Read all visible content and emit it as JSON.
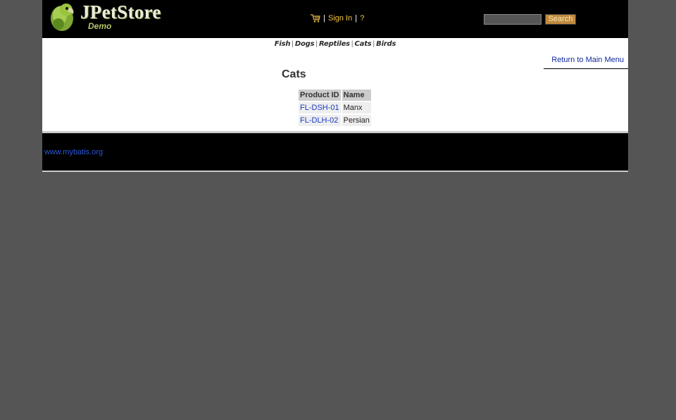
{
  "header": {
    "logo_title": "JPetStore",
    "logo_subtitle": "Demo",
    "cart_icon": "cart-icon",
    "separator": "|",
    "sign_in_label": "Sign In",
    "help_label": "?",
    "search_value": "",
    "search_button_label": "Search"
  },
  "quick_links": {
    "fish": "Fish",
    "dogs": "Dogs",
    "reptiles": "Reptiles",
    "cats": "Cats",
    "birds": "Birds",
    "separator": "|"
  },
  "main": {
    "back_link": "Return to Main Menu",
    "title": "Cats",
    "table": {
      "headers": [
        "Product ID",
        "Name"
      ],
      "rows": [
        {
          "product_id": "FL-DSH-01",
          "name": "Manx"
        },
        {
          "product_id": "FL-DLH-02",
          "name": "Persian"
        }
      ]
    }
  },
  "footer": {
    "link_text": "www.mybatis.org"
  },
  "colors": {
    "page_bg": "#555555",
    "header_bg": "#000000",
    "header_link": "#f5c542",
    "search_button_bg": "#c08a3e",
    "content_bg": "#ffffff",
    "table_header_bg": "#cccccc",
    "table_cell_bg": "#eeeeee",
    "link": "#1a3ac5"
  }
}
